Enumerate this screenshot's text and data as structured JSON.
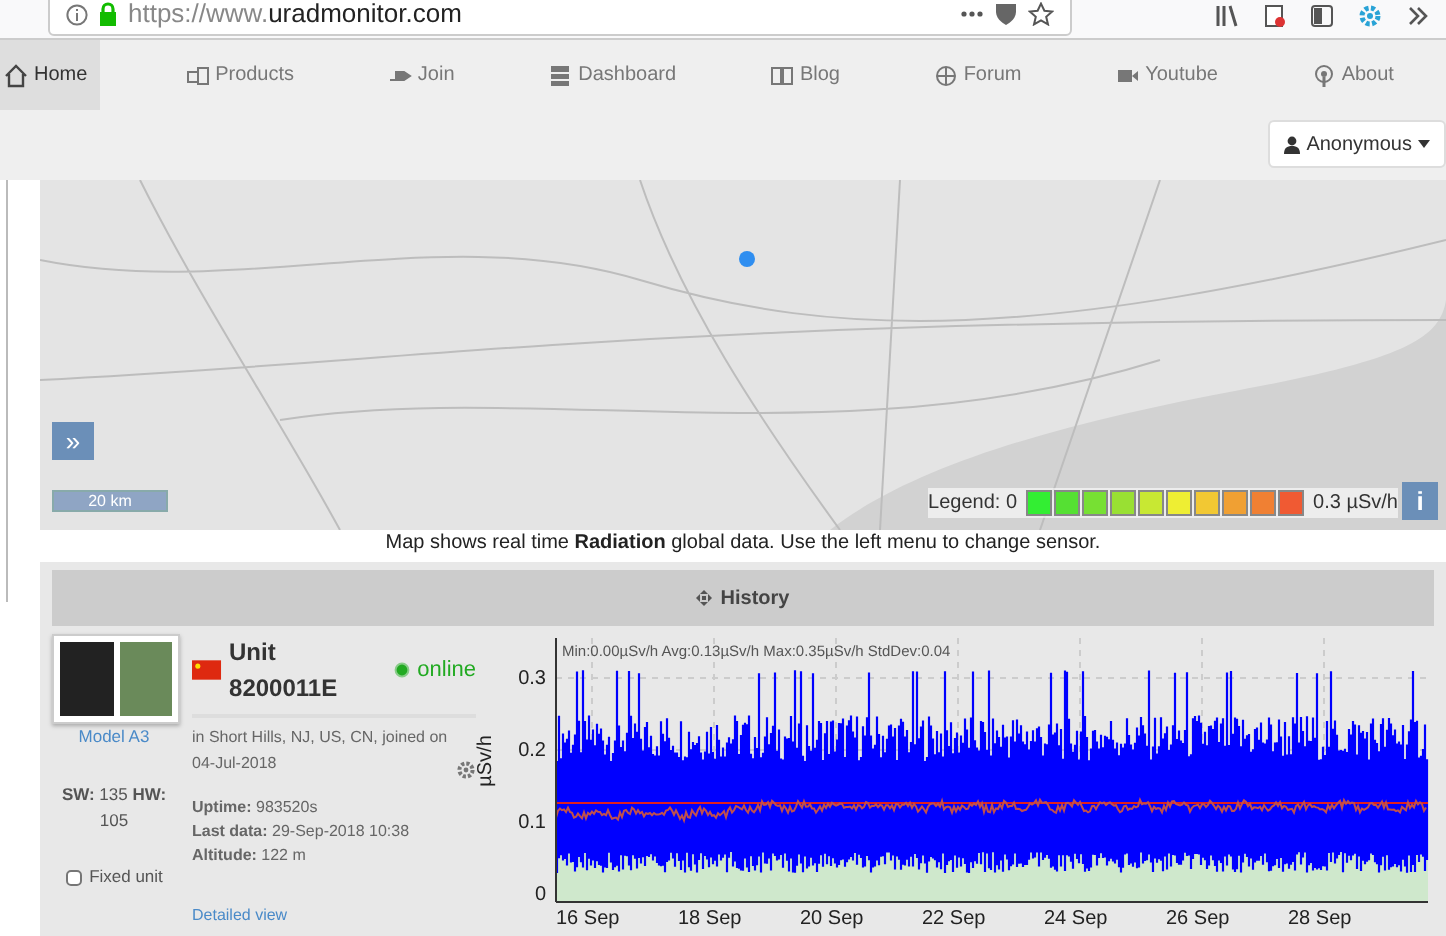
{
  "browser": {
    "url_prefix": "https://www.",
    "url_domain": "uradmonitor.com"
  },
  "nav": [
    {
      "label": "Home",
      "selected": true
    },
    {
      "label": "Products",
      "selected": false
    },
    {
      "label": "Join",
      "selected": false
    },
    {
      "label": "Dashboard",
      "selected": false
    },
    {
      "label": "Blog",
      "selected": false
    },
    {
      "label": "Forum",
      "selected": false
    },
    {
      "label": "Youtube",
      "selected": false
    },
    {
      "label": "About",
      "selected": false
    }
  ],
  "user_menu": {
    "label": "Anonymous"
  },
  "map": {
    "expand": "»",
    "scale": "20 km",
    "info": "i",
    "legend_label": "Legend: 0",
    "legend_max": "0.3 µSv/h",
    "legend": [
      {
        "color": "#33ee33"
      },
      {
        "color": "#55e033"
      },
      {
        "color": "#77e033"
      },
      {
        "color": "#99e033"
      },
      {
        "color": "#c8e833"
      },
      {
        "color": "#eeee33"
      },
      {
        "color": "#f2c833"
      },
      {
        "color": "#f0a033"
      },
      {
        "color": "#f08033"
      },
      {
        "color": "#f05a33"
      }
    ]
  },
  "caption": "Map shows real time **Radiation** global data. Use the left menu to change sensor.",
  "history": {
    "title": "History",
    "unit": {
      "model": "Model A3",
      "versions": "**SW:** 135 **HW:** 105",
      "fixed_unit": {
        "label": "Fixed unit",
        "checked": false
      },
      "name": "Unit 8200011E",
      "status": "online",
      "online": true,
      "location": "in Short Hills, NJ, US, CN, joined on 04-Jul-2018",
      "details": [
        "**Uptime:** 983520s",
        "**Last data:** 29-Sep-2018 10:38",
        "**Altitude:** 122 m"
      ],
      "link": "Detailed view"
    },
    "chart": {
      "stats": "Min:0.00µSv/h Avg:0.13µSv/h Max:0.35µSv/h StdDev:0.04",
      "ylabel": "µSv/h",
      "yticks": [
        "0.3",
        "0.2",
        "0.1",
        "0"
      ],
      "xticks": [
        "16 Sep",
        "18 Sep",
        "20 Sep",
        "22 Sep",
        "24 Sep",
        "26 Sep",
        "28 Sep"
      ]
    }
  }
}
